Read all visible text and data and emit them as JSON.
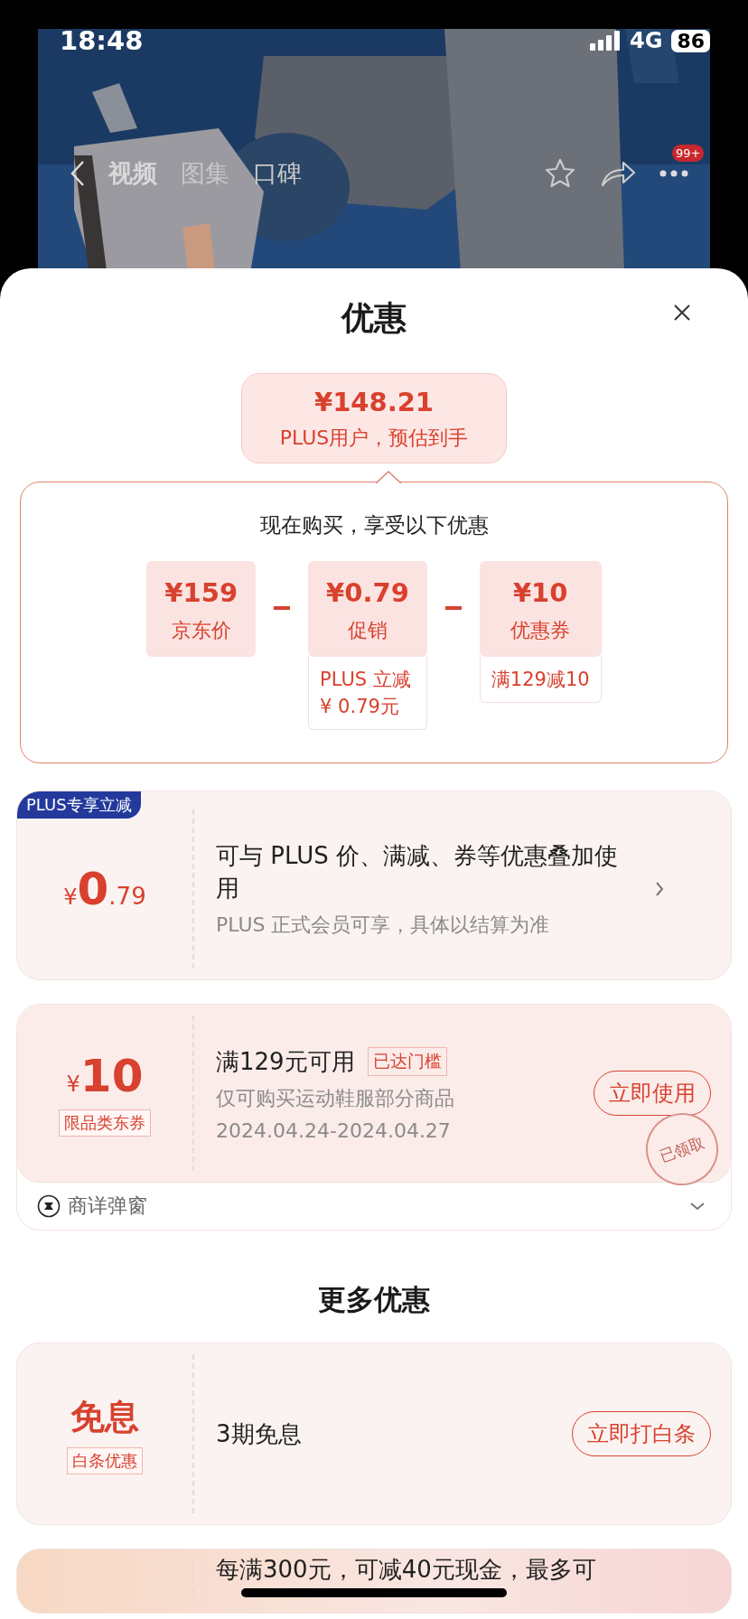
{
  "status_bar": {
    "time": "18:48",
    "network": "4G",
    "battery": "86"
  },
  "nav": {
    "tabs": [
      {
        "label": "视频",
        "selected": true
      },
      {
        "label": "图集",
        "selected": false
      },
      {
        "label": "口碑",
        "selected": false
      }
    ],
    "badge": "99+"
  },
  "sheet": {
    "title": "优惠"
  },
  "estimate": {
    "price": "¥148.21",
    "caption": "PLUS用户，预估到手"
  },
  "breakdown": {
    "heading": "现在购买，享受以下优惠",
    "items": [
      {
        "amount": "¥159",
        "label": "京东价"
      },
      {
        "amount": "¥0.79",
        "label": "促销",
        "details": [
          "PLUS 立减",
          "¥ 0.79元"
        ]
      },
      {
        "amount": "¥10",
        "label": "优惠券",
        "details": [
          "满129减10"
        ]
      }
    ]
  },
  "offers": [
    {
      "kind": "plus",
      "tag": "PLUS专享立减",
      "symbol": "¥",
      "amount": "0",
      "decimals": ".79",
      "title": "可与 PLUS 价、满减、券等优惠叠加使用",
      "subtitle": "PLUS 正式会员可享，具体以结算为准"
    },
    {
      "kind": "coupon",
      "symbol": "¥",
      "amount": "10",
      "badge": "限品类东券",
      "title": "满129元可用",
      "tag": "已达门槛",
      "desc": "仅可购买运动鞋服部分商品",
      "dates": "2024.04.24-2024.04.27",
      "button": "立即使用",
      "stamp": "已领取",
      "footer": "商详弹窗"
    }
  ],
  "more": {
    "heading": "更多优惠",
    "offers": [
      {
        "kind": "interest",
        "big": "免息",
        "badge": "白条优惠",
        "title": "3期免息",
        "button": "立即打白条"
      },
      {
        "kind": "cash",
        "title": "每满300元，可减40元现金，最多可"
      }
    ]
  }
}
